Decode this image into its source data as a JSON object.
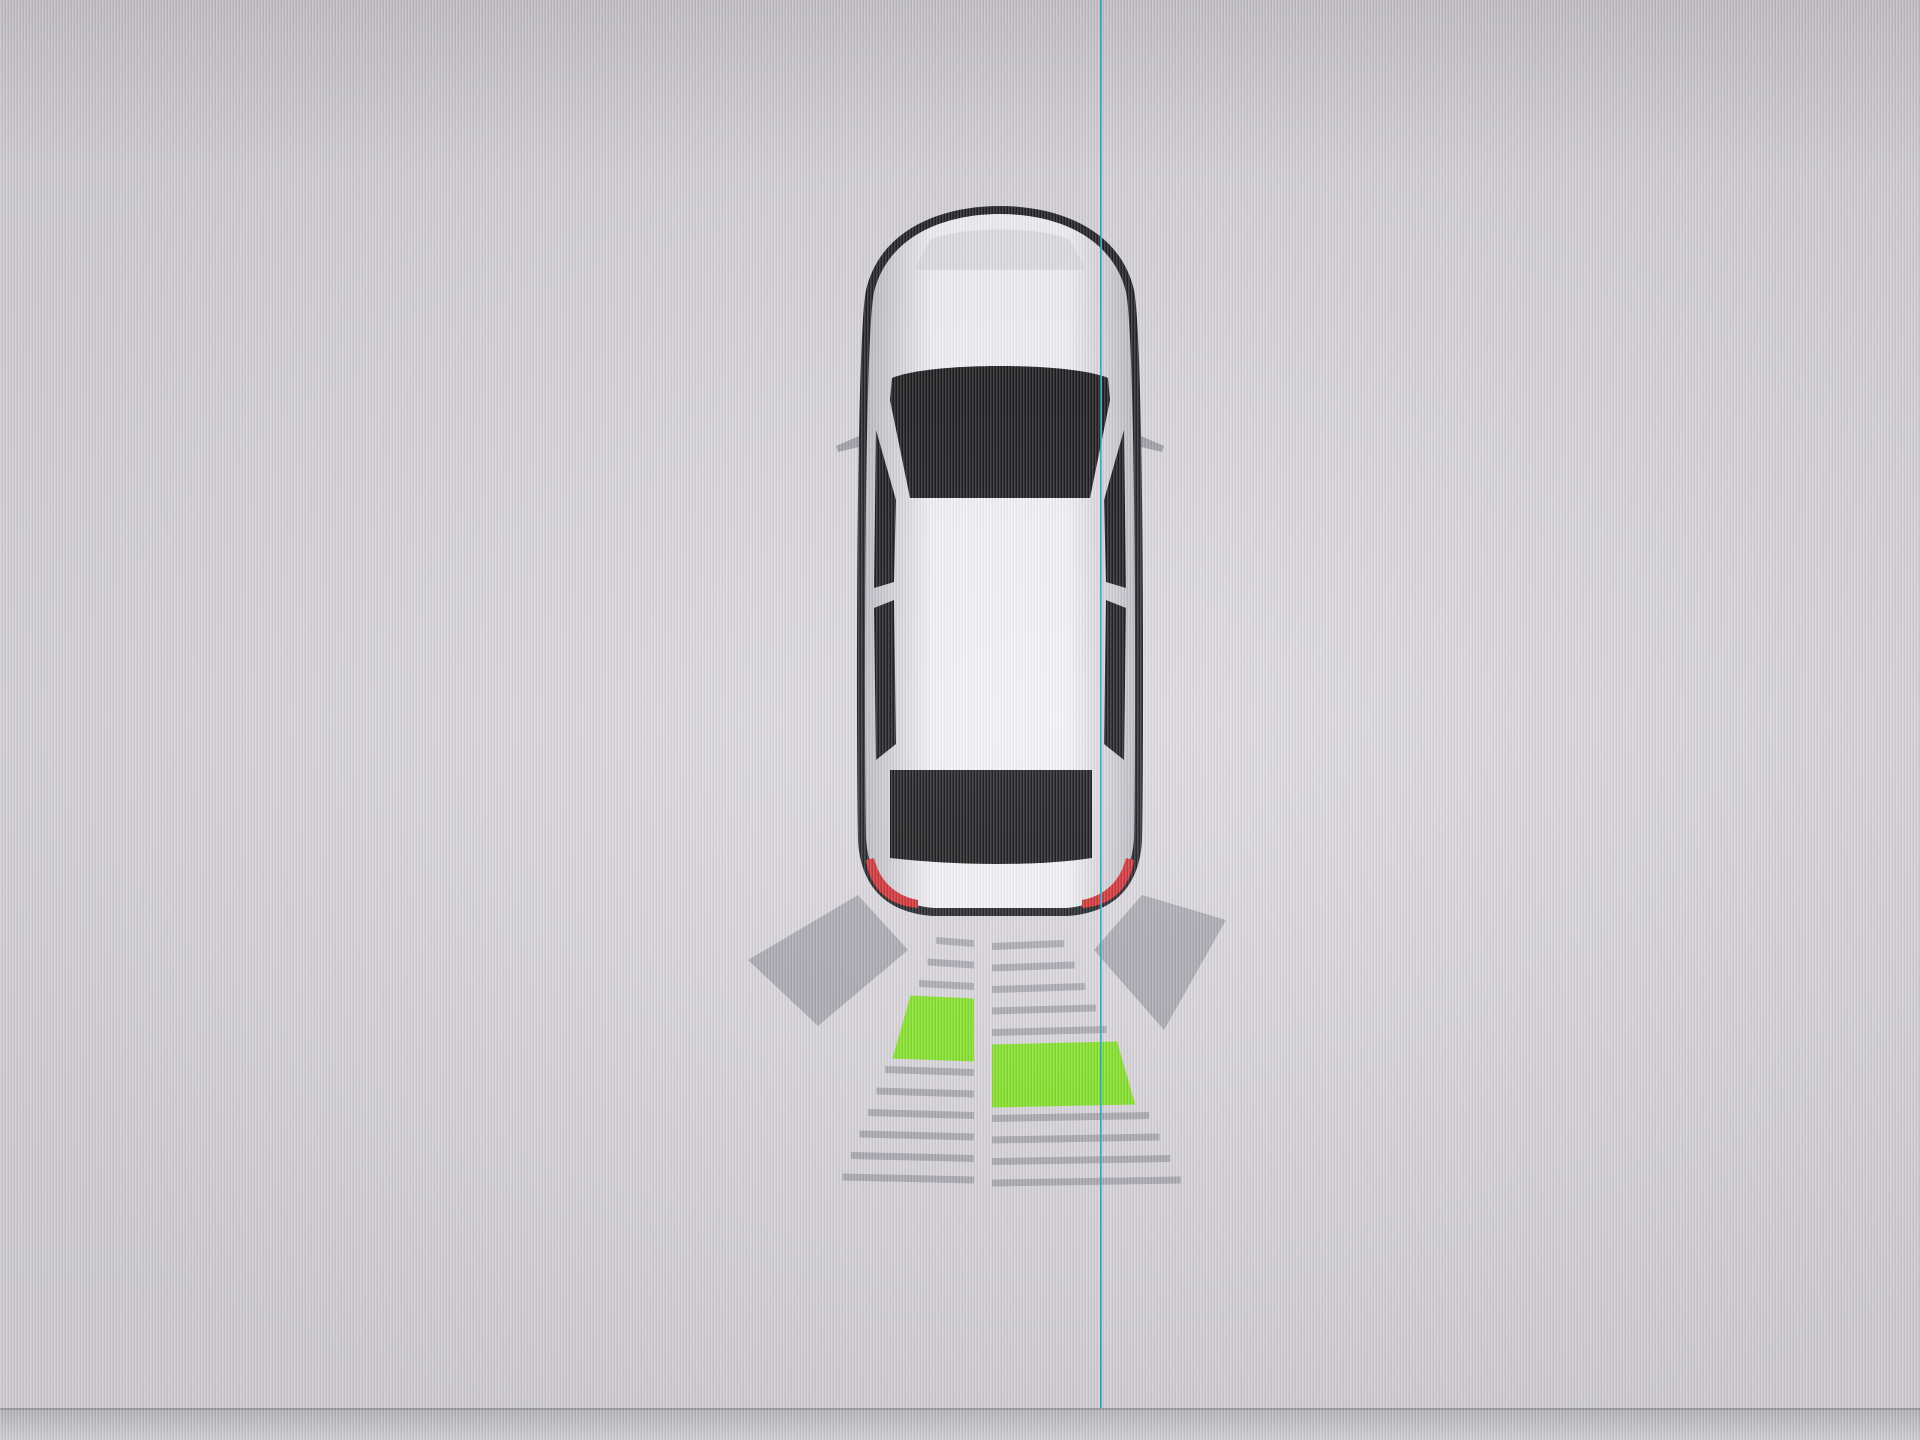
{
  "parking_sensor_display": {
    "vehicle": {
      "icon": "car-top-view-icon",
      "orientation": "rear-facing-down"
    },
    "rear_sensor_zones": [
      {
        "zone": "rear-left-corner",
        "active": false,
        "color": "#a9a8b0"
      },
      {
        "zone": "rear-left-center",
        "active": true,
        "active_level": 3,
        "total_levels": 12,
        "color": "#7fe41f"
      },
      {
        "zone": "rear-right-center",
        "active": true,
        "active_level": 5,
        "total_levels": 12,
        "color": "#7fe41f"
      },
      {
        "zone": "rear-right-corner",
        "active": false,
        "color": "#a9a8b0"
      }
    ],
    "colors": {
      "background": "#d8d5db",
      "car_body": "#f2f1f5",
      "car_glass": "#0f0f12",
      "inactive_bar": "#a9a8b0",
      "active_bar": "#7fe41f",
      "taillight": "#d0262b"
    }
  }
}
